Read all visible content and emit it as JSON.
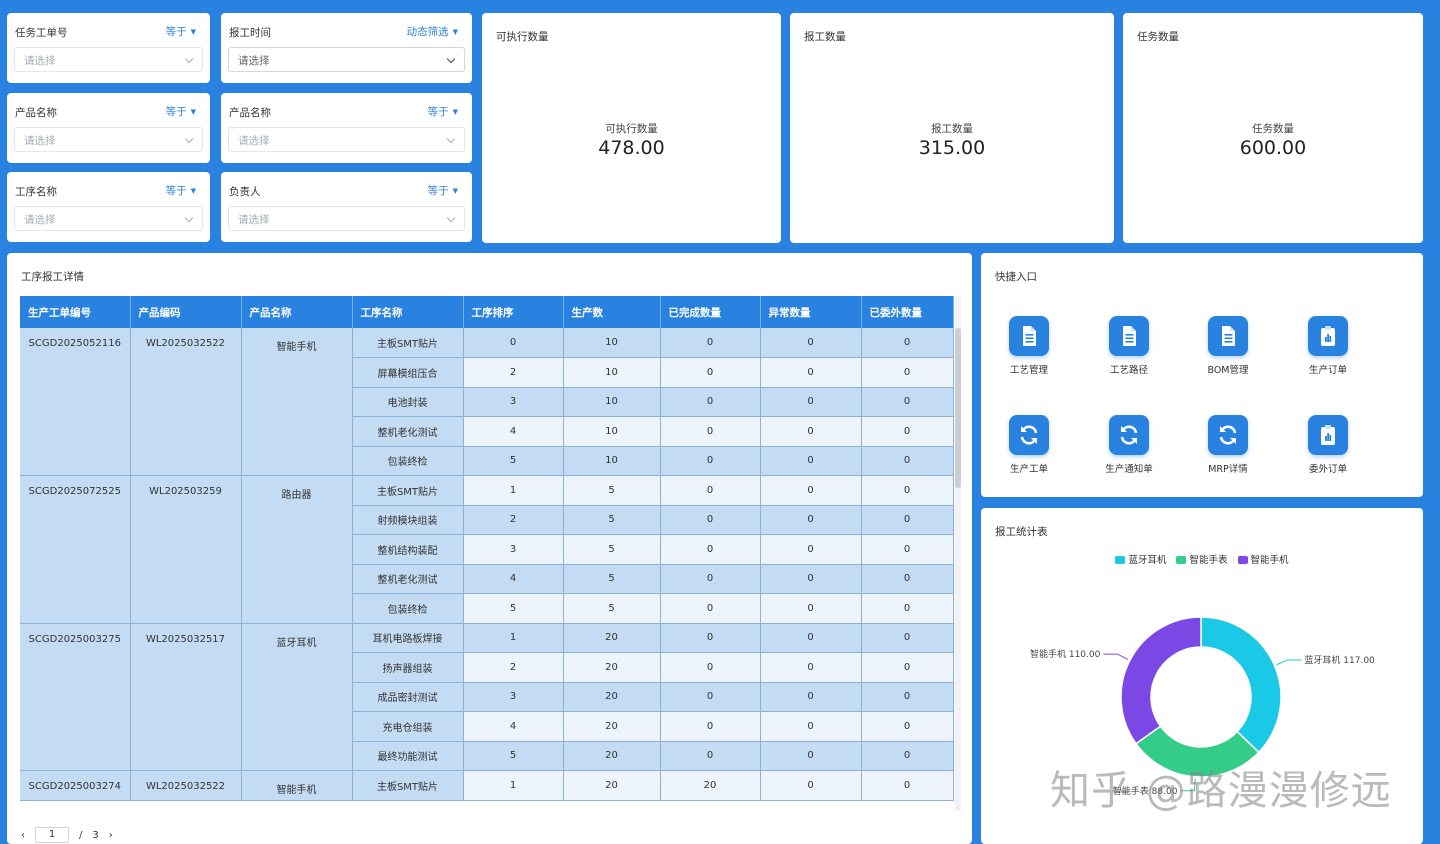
{
  "filters": [
    {
      "label": "任务工单号",
      "op": "等于",
      "placeholder": "请选择"
    },
    {
      "label": "报工时间",
      "op": "动态筛选",
      "placeholder": "请选择"
    },
    {
      "label": "产品名称",
      "op": "等于",
      "placeholder": "请选择"
    },
    {
      "label": "产品名称",
      "op": "等于",
      "placeholder": "请选择"
    },
    {
      "label": "工序名称",
      "op": "等于",
      "placeholder": "请选择"
    },
    {
      "label": "负责人",
      "op": "等于",
      "placeholder": "请选择"
    }
  ],
  "stats": [
    {
      "title": "可执行数量",
      "label": "可执行数量",
      "value": "478.00"
    },
    {
      "title": "报工数量",
      "label": "报工数量",
      "value": "315.00"
    },
    {
      "title": "任务数量",
      "label": "任务数量",
      "value": "600.00"
    }
  ],
  "table": {
    "title": "工序报工详情",
    "columns": [
      "生产工单编号",
      "产品编码",
      "产品名称",
      "工序名称",
      "工序排序",
      "生产数",
      "已完成数量",
      "异常数量",
      "已委外数量"
    ],
    "groups": [
      {
        "order_no": "SCGD2025052116",
        "product_code": "WL2025032522",
        "product_name": "智能手机",
        "rows": [
          {
            "process": "主板SMT贴片",
            "seq": "0",
            "qty": "10",
            "done": "0",
            "abnormal": "0",
            "outsourced": "0"
          },
          {
            "process": "屏幕模组压合",
            "seq": "2",
            "qty": "10",
            "done": "0",
            "abnormal": "0",
            "outsourced": "0"
          },
          {
            "process": "电池封装",
            "seq": "3",
            "qty": "10",
            "done": "0",
            "abnormal": "0",
            "outsourced": "0"
          },
          {
            "process": "整机老化测试",
            "seq": "4",
            "qty": "10",
            "done": "0",
            "abnormal": "0",
            "outsourced": "0"
          },
          {
            "process": "包装终检",
            "seq": "5",
            "qty": "10",
            "done": "0",
            "abnormal": "0",
            "outsourced": "0"
          }
        ]
      },
      {
        "order_no": "SCGD2025072525",
        "product_code": "WL202503259",
        "product_name": "路由器",
        "rows": [
          {
            "process": "主板SMT贴片",
            "seq": "1",
            "qty": "5",
            "done": "0",
            "abnormal": "0",
            "outsourced": "0"
          },
          {
            "process": "射频模块组装",
            "seq": "2",
            "qty": "5",
            "done": "0",
            "abnormal": "0",
            "outsourced": "0"
          },
          {
            "process": "整机结构装配",
            "seq": "3",
            "qty": "5",
            "done": "0",
            "abnormal": "0",
            "outsourced": "0"
          },
          {
            "process": "整机老化测试",
            "seq": "4",
            "qty": "5",
            "done": "0",
            "abnormal": "0",
            "outsourced": "0"
          },
          {
            "process": "包装终检",
            "seq": "5",
            "qty": "5",
            "done": "0",
            "abnormal": "0",
            "outsourced": "0"
          }
        ]
      },
      {
        "order_no": "SCGD2025003275",
        "product_code": "WL2025032517",
        "product_name": "蓝牙耳机",
        "rows": [
          {
            "process": "耳机电路板焊接",
            "seq": "1",
            "qty": "20",
            "done": "0",
            "abnormal": "0",
            "outsourced": "0"
          },
          {
            "process": "扬声器组装",
            "seq": "2",
            "qty": "20",
            "done": "0",
            "abnormal": "0",
            "outsourced": "0"
          },
          {
            "process": "成品密封测试",
            "seq": "3",
            "qty": "20",
            "done": "0",
            "abnormal": "0",
            "outsourced": "0"
          },
          {
            "process": "充电仓组装",
            "seq": "4",
            "qty": "20",
            "done": "0",
            "abnormal": "0",
            "outsourced": "0"
          },
          {
            "process": "最终功能测试",
            "seq": "5",
            "qty": "20",
            "done": "0",
            "abnormal": "0",
            "outsourced": "0"
          }
        ]
      },
      {
        "order_no": "SCGD2025003274",
        "product_code": "WL2025032522",
        "product_name": "智能手机",
        "rows": [
          {
            "process": "主板SMT贴片",
            "seq": "1",
            "qty": "20",
            "done": "20",
            "abnormal": "0",
            "outsourced": "0"
          }
        ]
      }
    ]
  },
  "pager": {
    "prev": "‹",
    "page": "1",
    "sep": "/",
    "total": "3",
    "next": "›"
  },
  "quick": {
    "title": "快捷入口",
    "items": [
      {
        "label": "工艺管理",
        "icon": "document-icon"
      },
      {
        "label": "工艺路径",
        "icon": "document-icon"
      },
      {
        "label": "BOM管理",
        "icon": "document-icon"
      },
      {
        "label": "生产订单",
        "icon": "clipboard-icon"
      },
      {
        "label": "生产工单",
        "icon": "refresh-icon"
      },
      {
        "label": "生产通知单",
        "icon": "refresh-icon"
      },
      {
        "label": "MRP详情",
        "icon": "refresh-icon"
      },
      {
        "label": "委外订单",
        "icon": "clipboard-icon"
      }
    ]
  },
  "chart_data": {
    "type": "pie",
    "title": "报工统计表",
    "series": [
      {
        "name": "蓝牙耳机",
        "value": 117.0,
        "color": "#19c9e6",
        "label": "蓝牙耳机 117.00"
      },
      {
        "name": "智能手表",
        "value": 88.0,
        "color": "#33cc88",
        "label": "智能手表 88.00"
      },
      {
        "name": "智能手机",
        "value": 110.0,
        "color": "#7b47e5",
        "label": "智能手机 110.00"
      }
    ],
    "legend_position": "top-center"
  },
  "watermark": "知乎 @路漫漫修远"
}
